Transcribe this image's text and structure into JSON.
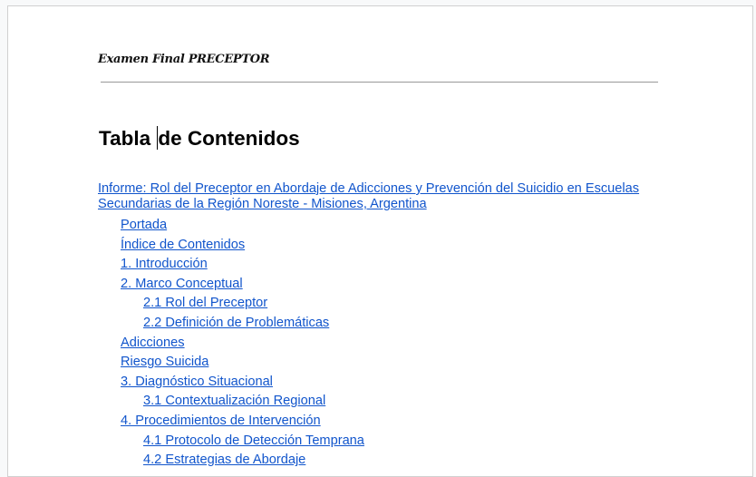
{
  "document": {
    "header_text": "Examen Final PRECEPTOR",
    "title_before_cursor": "Tabla ",
    "title_after_cursor": "de Contenidos",
    "toc": [
      {
        "text": "Informe: Rol del Preceptor en Abordaje de Adicciones y Prevención del Suicidio en Escuelas Secundarias de la Región Noreste - Misiones, Argentina",
        "level": 0
      },
      {
        "text": "Portada",
        "level": 1
      },
      {
        "text": "Índice de Contenidos",
        "level": 1
      },
      {
        "text": "1. Introducción",
        "level": 1
      },
      {
        "text": "2. Marco Conceptual",
        "level": 1
      },
      {
        "text": "2.1 Rol del Preceptor",
        "level": 2
      },
      {
        "text": "2.2 Definición de Problemáticas",
        "level": 2
      },
      {
        "text": "Adicciones",
        "level": 1
      },
      {
        "text": "Riesgo Suicida",
        "level": 1
      },
      {
        "text": "3. Diagnóstico Situacional",
        "level": 1
      },
      {
        "text": "3.1 Contextualización Regional",
        "level": 2
      },
      {
        "text": "4. Procedimientos de Intervención",
        "level": 1
      },
      {
        "text": "4.1 Protocolo de Detección Temprana",
        "level": 2
      },
      {
        "text": "4.2 Estrategias de Abordaje",
        "level": 2
      }
    ]
  },
  "colors": {
    "link": "#1155cc",
    "rule": "#999999"
  }
}
